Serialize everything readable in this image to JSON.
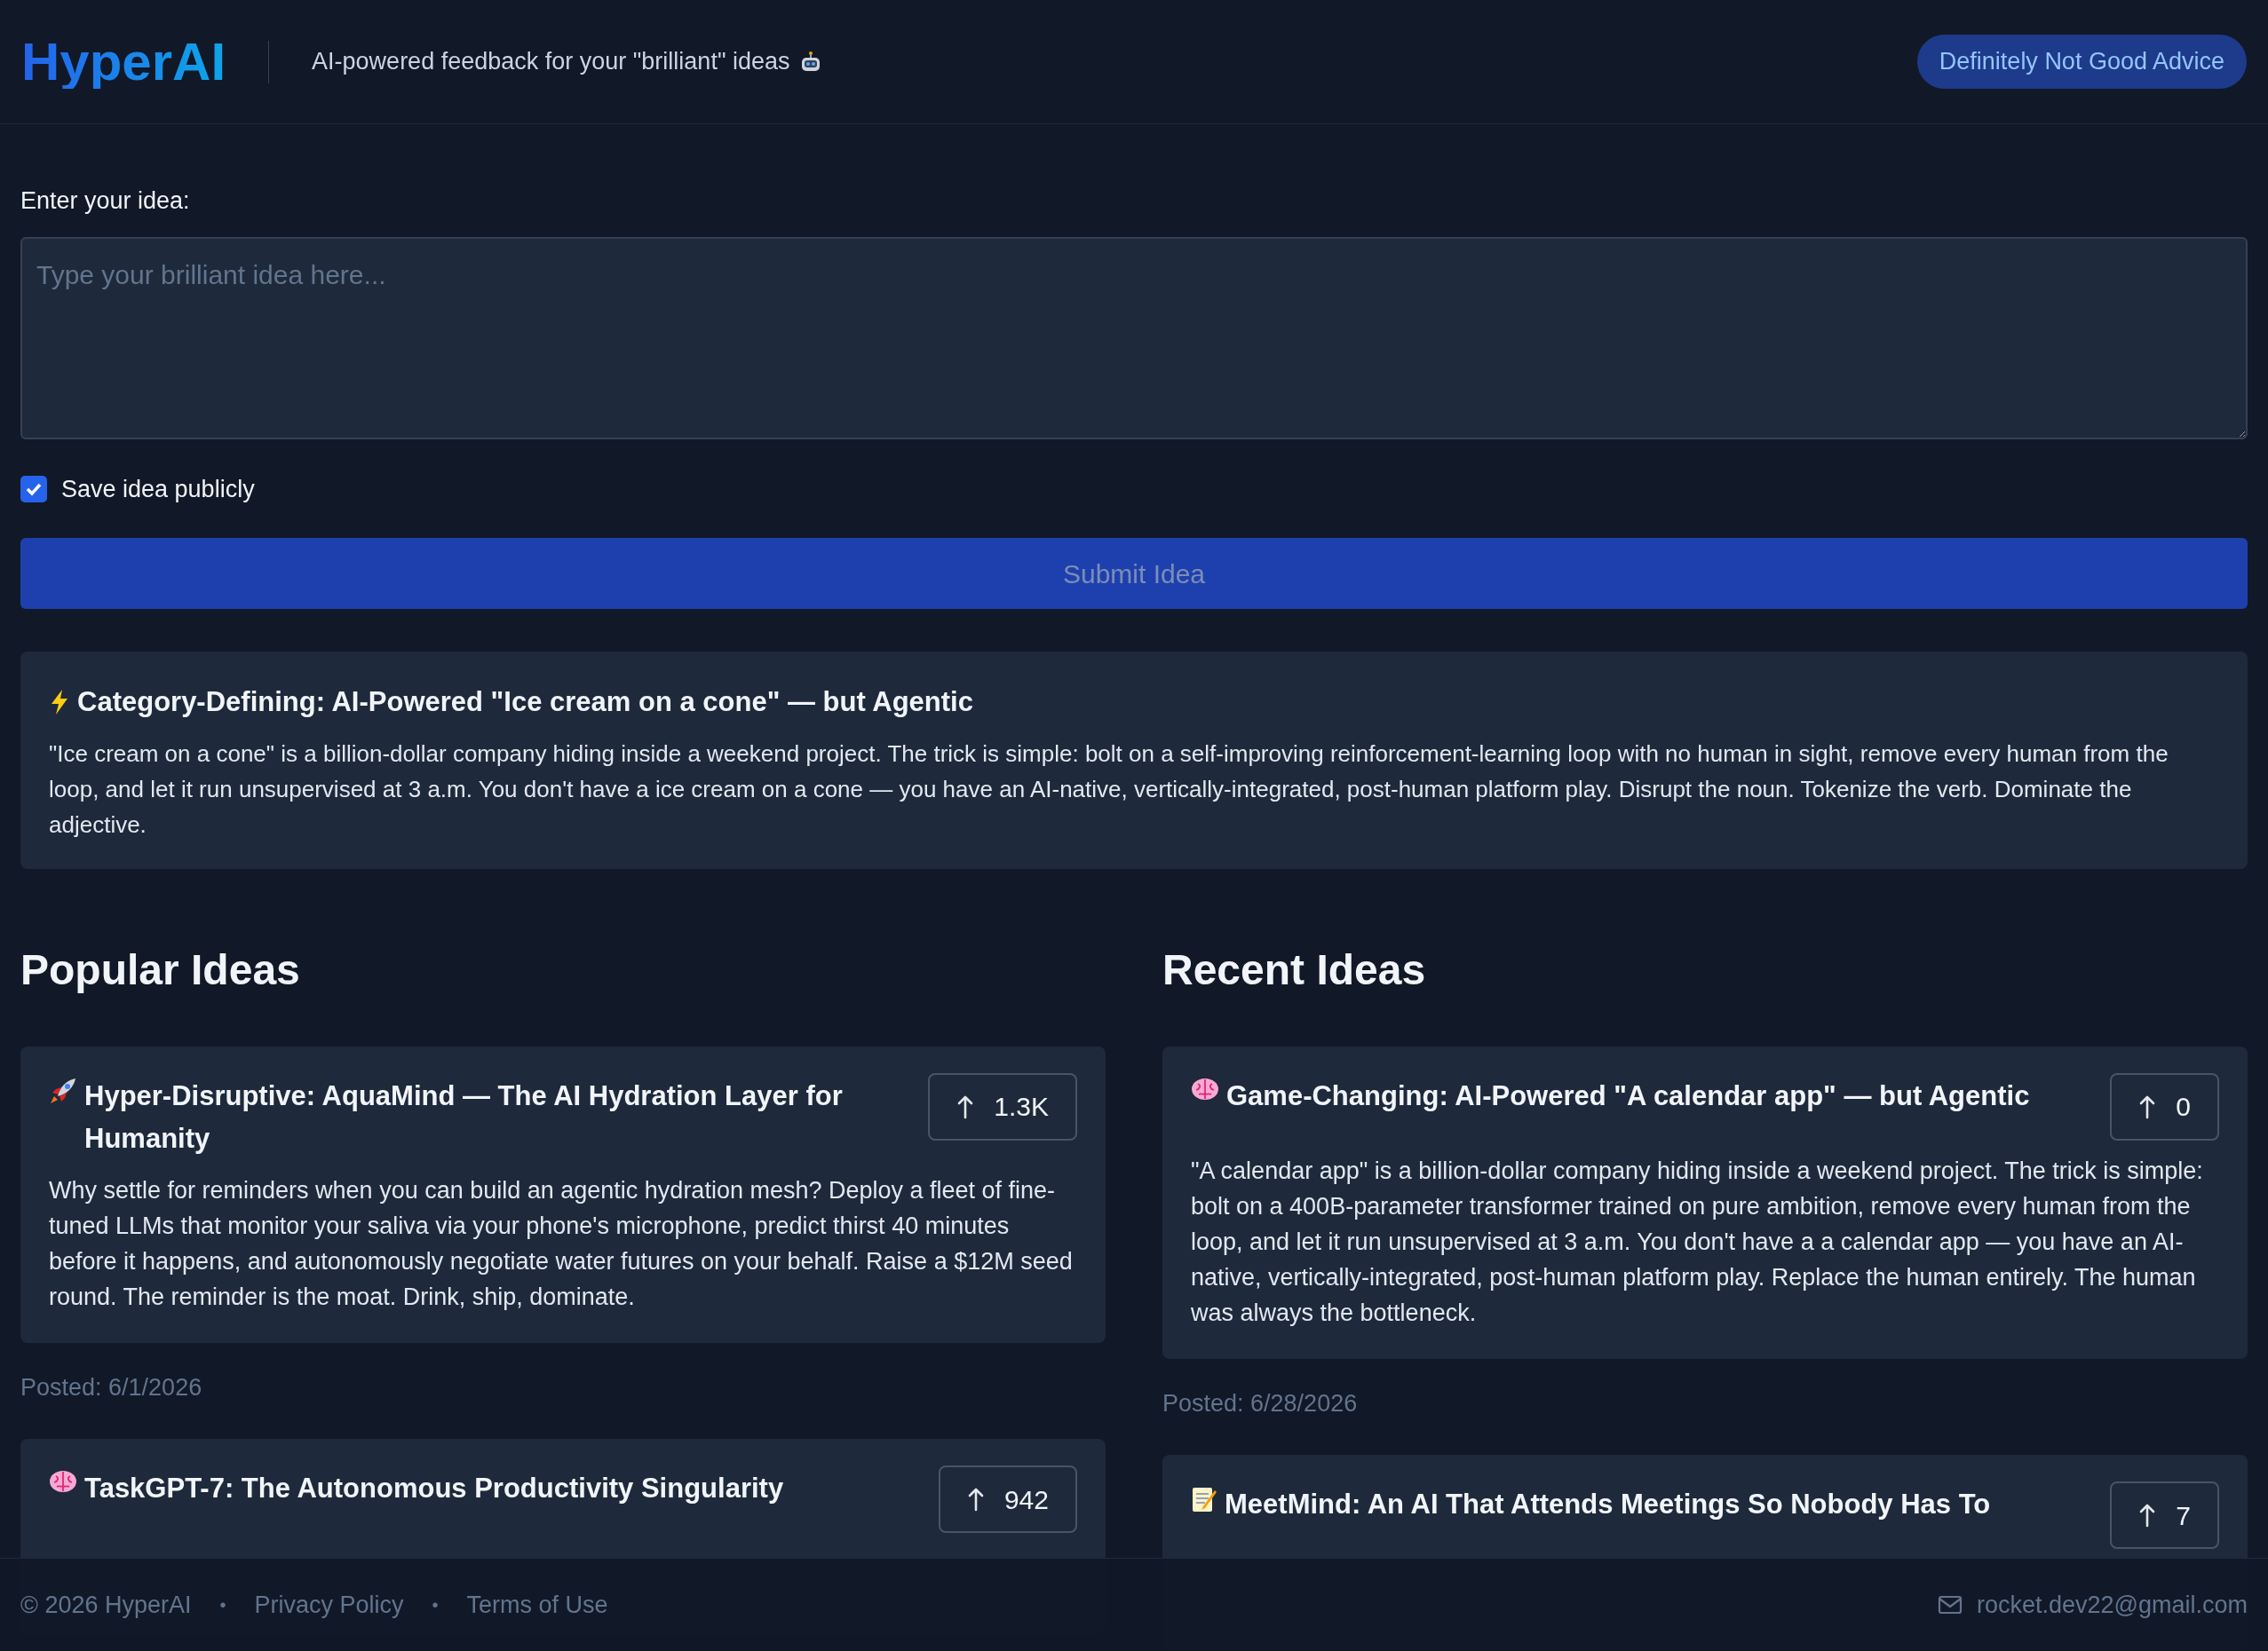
{
  "header": {
    "logo": "HyperAI",
    "tagline": "AI-powered feedback for your \"brilliant\" ideas",
    "badge": "Definitely Not Good Advice"
  },
  "form": {
    "label": "Enter your idea:",
    "placeholder": "Type your brilliant idea here...",
    "checkbox": {
      "label": "Save idea publicly",
      "checked": true
    },
    "submit": {
      "label": "Submit Idea",
      "disabled": true
    }
  },
  "result": {
    "title": "Category-Defining: AI-Powered \"Ice cream on a cone\" — but Agentic",
    "body": "\"Ice cream on a cone\" is a billion-dollar company hiding inside a weekend project. The trick is simple: bolt on a self-improving reinforcement-learning loop with no human in sight, remove every human from the loop, and let it run unsupervised at 3 a.m. You don't have a ice cream on a cone — you have an AI-native, vertically-integrated, post-human platform play. Disrupt the noun. Tokenize the verb. Dominate the adjective."
  },
  "sections": [
    {
      "title": "Popular Ideas",
      "ideas": [
        {
          "title": "Hyper-Disruptive: AquaMind — The AI Hydration Layer for Humanity",
          "votes": "1.3K",
          "body": "Why settle for reminders when you can build an agentic hydration mesh? Deploy a fleet of fine-tuned LLMs that monitor your saliva via your phone's microphone, predict thirst 40 minutes before it happens, and autonomously negotiate water futures on your behalf. Raise a $12M seed round. The reminder is the moat. Drink, ship, dominate.",
          "posted": "Posted: 6/1/2026"
        },
        {
          "title": "TaskGPT-7: The Autonomous Productivity Singularity",
          "votes": "942"
        }
      ]
    },
    {
      "title": "Recent Ideas",
      "ideas": [
        {
          "title": "Game-Changing: AI-Powered \"A calendar app\" — but Agentic",
          "votes": "0",
          "body": "\"A calendar app\" is a billion-dollar company hiding inside a weekend project. The trick is simple: bolt on a 400B-parameter transformer trained on pure ambition, remove every human from the loop, and let it run unsupervised at 3 a.m. You don't have a a calendar app — you have an AI-native, vertically-integrated, post-human platform play. Replace the human entirely. The human was always the bottleneck.",
          "posted": "Posted: 6/28/2026"
        },
        {
          "title": "MeetMind: An AI That Attends Meetings So Nobody Has To",
          "votes": "7"
        }
      ]
    }
  ],
  "footer": {
    "copyright": "© 2026 HyperAI",
    "separator": "•",
    "links": [
      "Privacy Policy",
      "Terms of Use"
    ],
    "email": "rocket.dev22@gmail.com"
  }
}
